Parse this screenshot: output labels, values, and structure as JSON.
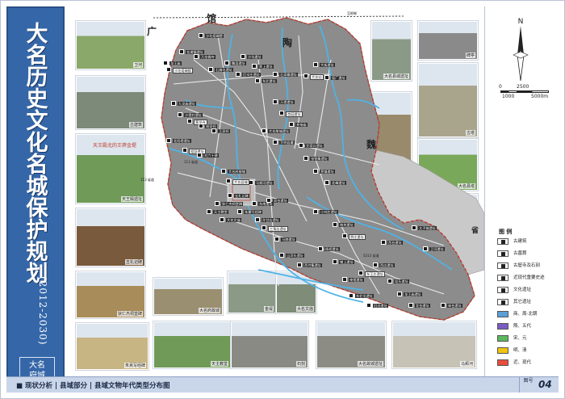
{
  "title": {
    "chars": [
      "大",
      "名",
      "历",
      "史",
      "文",
      "化",
      "名",
      "城",
      "保",
      "护",
      "规",
      "划"
    ],
    "years": "(2012-2030)",
    "seal": [
      "大",
      "名",
      "府",
      "城"
    ]
  },
  "map": {
    "place_names": [
      "馆",
      "陶",
      "广",
      "魏",
      "省"
    ],
    "river_labels": [
      "至邯郸",
      "113 省道",
      "113 省道",
      "S313 省道"
    ],
    "site_labels": [
      "沙圪塔碉堡",
      "金滩镇遗址",
      "龙王庙",
      "沙圪塔碉楼",
      "万金佛寺",
      "石佛屯遗址",
      "魏县遗址",
      "后辛庄遗址",
      "九龙庙遗址",
      "沙堤村遗址",
      "黄龙寺",
      "周家祠",
      "王家祠",
      "沙坑遗址",
      "冢上遗址",
      "东北遗址",
      "北阳堤遗址",
      "程邱遗址",
      "刘六十碑",
      "大名府故城",
      "五礼记碑",
      "狄仁杰祠堂碑",
      "朱熹写经碑",
      "马颊河遗址",
      "大名县城",
      "天主教堂",
      "大名文庙",
      "东南遗址",
      "孙甘店遗址",
      "双台遗址",
      "万堤遗址",
      "杏园遗址",
      "关帝庙",
      "大名故城遗址",
      "大明县署",
      "艾家口遗址",
      "张铁集遗址",
      "营镇遗址",
      "三角店遗址",
      "马陵遗址",
      "山洋头遗址",
      "西付集遗址",
      "杨桥遗址",
      "铺上遗址",
      "束馆遗址",
      "东王庄遗址",
      "西店遗址",
      "埝头遗址",
      "龙王庙遗址",
      "东北屯遗址",
      "旧治遗址",
      "南关遗址",
      "贾庄遗址",
      "小刘庄遗址",
      "北峰遗址",
      "大街遗址",
      "窑厂遗址",
      "太子城遗址",
      "卫河遗址",
      "大名站",
      "石家寨遗址",
      "林台遗址",
      "北台遗址",
      "西台遗址"
    ]
  },
  "photos": [
    {
      "caption": "卫河"
    },
    {
      "caption": "古建筑"
    },
    {
      "caption": "天王殿遗址",
      "inner": "天王殿北的王莽金堤"
    },
    {
      "caption": "五礼记碑"
    },
    {
      "caption": "狄仁杰祠堂碑"
    },
    {
      "caption": "朱熹写经碑"
    },
    {
      "caption": "大名府故城"
    },
    {
      "caption": "金堤"
    },
    {
      "caption": "大名文庙"
    },
    {
      "caption": "天主教堂"
    },
    {
      "caption": "石刻"
    },
    {
      "caption": "大名故城遗址"
    },
    {
      "caption": "马颊河"
    },
    {
      "caption": "大名县城遗址"
    },
    {
      "caption": "碑亭"
    },
    {
      "caption": "古塔"
    },
    {
      "caption": "石碑"
    },
    {
      "caption": "大名县塔"
    },
    {
      "caption": "墓碑"
    },
    {
      "caption": "大名府署"
    }
  ],
  "north": "N",
  "scale": {
    "top": [
      "0",
      "2500"
    ],
    "bottom": [
      "1000",
      "5000m"
    ]
  },
  "legend": {
    "title": "图 例",
    "items": [
      {
        "label": "古建筑",
        "color": "#ffffff",
        "icon": "ancient-building-icon"
      },
      {
        "label": "古墓葬",
        "color": "#ffffff",
        "icon": "tomb-icon"
      },
      {
        "label": "古窟寺及石刻",
        "color": "#ffffff",
        "icon": "grotto-icon"
      },
      {
        "label": "近现代重要史迹",
        "color": "#ffffff",
        "icon": "modern-site-icon"
      },
      {
        "label": "文化遗址",
        "color": "#ffffff",
        "icon": "site-icon"
      },
      {
        "label": "其它遗址",
        "color": "#ffffff",
        "icon": "other-site-icon"
      },
      {
        "label": "商、周-北朝",
        "color": "#5aa0d8"
      },
      {
        "label": "隋、五代",
        "color": "#7b5cc4"
      },
      {
        "label": "宋、元",
        "color": "#5cb85c"
      },
      {
        "label": "明、清",
        "color": "#f1c40f"
      },
      {
        "label": "近、现代",
        "color": "#e74c3c"
      }
    ]
  },
  "bottom_bar": {
    "text": "■ 现状分析 | 县域部分 | 县域文物年代类型分布图",
    "sheet_label": "图号",
    "sheet_number": "04"
  },
  "colors": {
    "title_bg": "#3567a8",
    "map_fill": "#8c8c8c",
    "river": "#4fb3e6",
    "road": "#e9e9e9",
    "border": "#c0392b"
  }
}
